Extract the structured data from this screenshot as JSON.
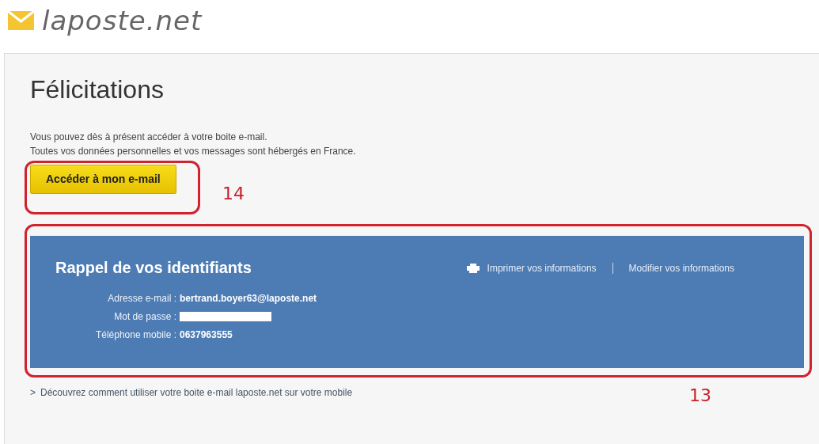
{
  "logo": {
    "text": "laposte.net"
  },
  "title": "Félicitations",
  "intro": [
    "Vous pouvez dès à présent accéder à votre boite e-mail.",
    "Toutes vos données personnelles et vos messages sont hébergés en France."
  ],
  "primary_button": "Accéder à mon e-mail",
  "credentials": {
    "heading": "Rappel de vos identifiants",
    "actions": [
      {
        "label": "Imprimer vos informations",
        "kind": "print"
      },
      {
        "label": "Modifier vos informations",
        "kind": "link"
      }
    ],
    "fields": [
      {
        "label": "Adresse e-mail :",
        "value": "bertrand.boyer63@laposte.net",
        "kind": "text"
      },
      {
        "label": "Mot de passe :",
        "kind": "masked"
      },
      {
        "label": "Téléphone mobile :",
        "value": "0637963555",
        "kind": "text"
      }
    ]
  },
  "mobile_link": {
    "arrow": ">",
    "text": "Découvrez comment utiliser votre boite e-mail laposte.net sur votre mobile"
  },
  "annotations": [
    {
      "kind": "button",
      "label": "14"
    },
    {
      "kind": "panel",
      "label": "13"
    }
  ]
}
